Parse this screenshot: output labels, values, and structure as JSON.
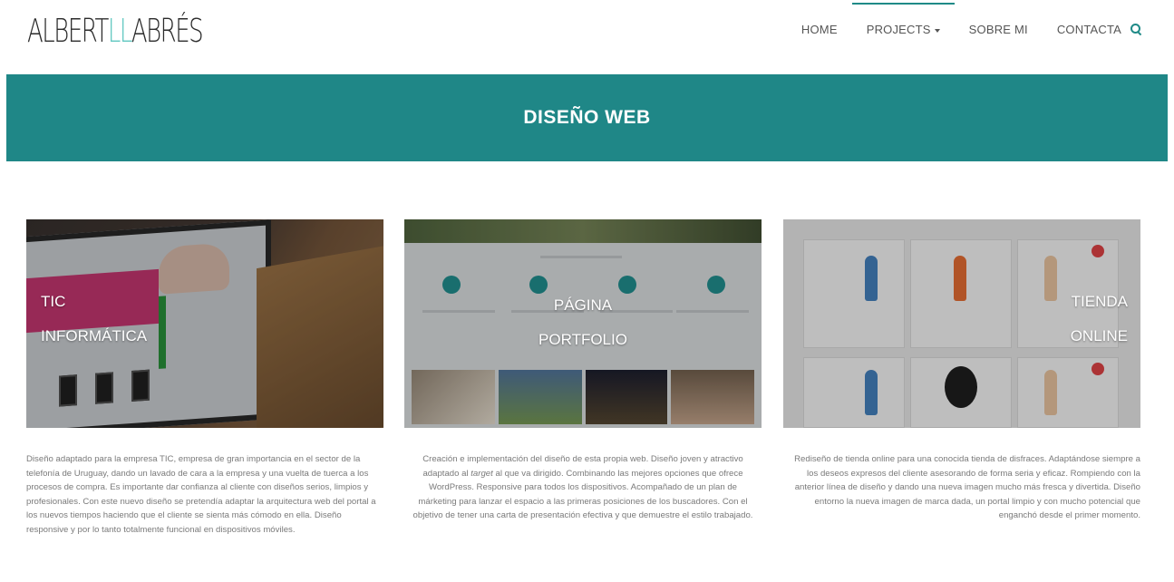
{
  "header": {
    "logo_part1": "ALBERT",
    "logo_accent": "LL",
    "logo_part2": "ABRÉS",
    "nav": [
      {
        "label": "HOME"
      },
      {
        "label": "PROJECTS"
      },
      {
        "label": "SOBRE MI"
      },
      {
        "label": "CONTACTA"
      }
    ]
  },
  "banner": {
    "title": "DISEÑO WEB"
  },
  "cards": [
    {
      "overlay_line1": "TIC",
      "overlay_line2": "INFORMÁTICA",
      "description": "Diseño adaptado para la empresa TIC, empresa de gran importancia en el sector de la telefonía de Uruguay, dando un lavado de cara a la empresa y una vuelta de tuerca a los procesos de compra. Es importante dar confianza al cliente con diseños serios, limpios y profesionales. Con este nuevo diseño se pretendía adaptar la arquitectura web del portal a los nuevos tiempos haciendo que el cliente se sienta más cómodo en ella. Diseño responsive y por lo tanto totalmente funcional en dispositivos móviles."
    },
    {
      "overlay_line1": "PÁGINA",
      "overlay_line2": "PORTFOLIO",
      "description_a": "Creación e implementación del diseño de esta propia web. Diseño joven y atractivo adaptado al ",
      "description_em": "target",
      "description_b": " al que va dirigido. Combinando las mejores opciones que ofrece WordPress. Responsive para todos los dispositivos. Acompañado de un plan de márketing para lanzar el espacio a las primeras posiciones de los buscadores. Con el objetivo de tener una carta de presentación efectiva y que demuestre el estilo trabajado."
    },
    {
      "overlay_line1": "TIENDA",
      "overlay_line2": "ONLINE",
      "description": "Rediseño de tienda online para una conocida tienda de disfraces. Adaptándose siempre a los deseos expresos del cliente asesorando de forma seria y eficaz. Rompiendo con la anterior línea de diseño y dando una nueva imagen mucho más fresca y divertida. Diseño entorno la nueva imagen de marca dada, un portal limpio y con mucho potencial que enganchó desde el primer momento."
    }
  ],
  "colors": {
    "accent": "#1f8787",
    "logo_accent": "#5fc7c0"
  },
  "icons": [
    "caret-down-icon",
    "search-icon"
  ]
}
